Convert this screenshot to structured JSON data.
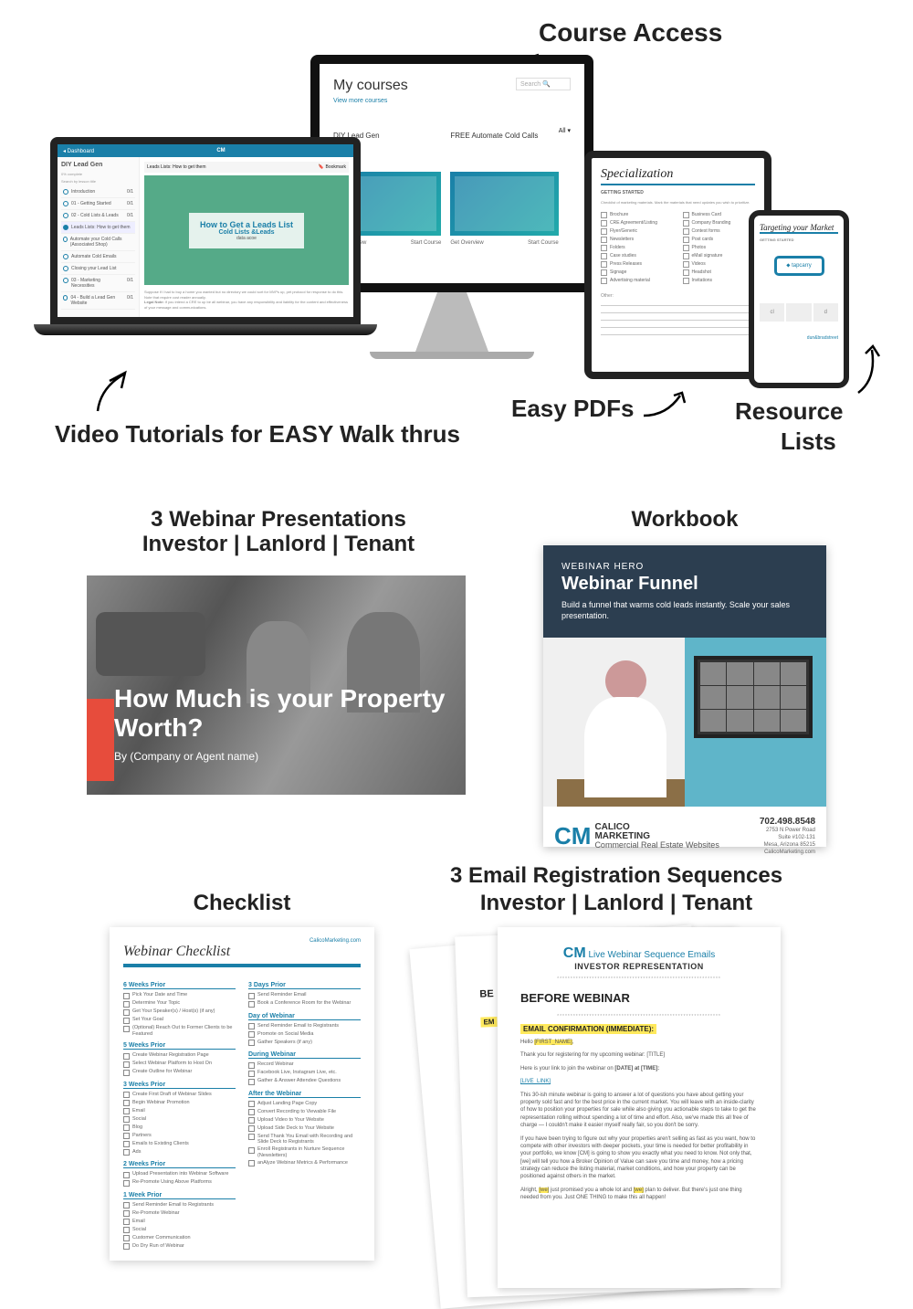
{
  "labels": {
    "course_access": "Course Access",
    "video_tutorials": "Video Tutorials for EASY Walk thrus",
    "easy_pdfs": "Easy PDFs",
    "resource": "Resource",
    "lists": "Lists",
    "webinar_line1": "3 Webinar Presentations",
    "webinar_line2": "Investor | Lanlord | Tenant",
    "workbook": "Workbook",
    "checklist": "Checklist",
    "email_line1": "3 Email Registration Sequences",
    "email_line2": "Investor | Lanlord | Tenant"
  },
  "monitor": {
    "title": "My courses",
    "link": "View more courses",
    "search_ph": "Search",
    "all": "All ▾",
    "cards": [
      {
        "title": "DIY Lead Gen",
        "b1": "Get Overview",
        "b2": "Start Course"
      },
      {
        "title": "FREE Automate Cold Calls",
        "b1": "Get Overview",
        "b2": "Start Course"
      }
    ]
  },
  "laptop": {
    "bar": "◂ Dashboard",
    "side_title": "DIY Lead Gen",
    "progress": "0% complete",
    "search": "Search by lesson title",
    "items": [
      {
        "t": "Introduction",
        "n": "0/1"
      },
      {
        "t": "01 - Getting Started",
        "n": "0/1"
      },
      {
        "t": "02 - Cold Lists & Leads",
        "n": "0/1"
      },
      {
        "t": "Leads Lists: How to get them",
        "n": ""
      },
      {
        "t": "Automate your Cold Calls (Associated Shop)",
        "n": ""
      },
      {
        "t": "Automate Cold Emails",
        "n": ""
      },
      {
        "t": "Closing your Lead List",
        "n": ""
      },
      {
        "t": "03 - Marketing Necessities",
        "n": "0/1"
      },
      {
        "t": "04 - Build a Lead Gen Website",
        "n": "0/1"
      }
    ],
    "content_bar": "Leads Lists: How to get them",
    "bookmark": "🔖 Bookmark",
    "hero_t1": "How to Get a Leads List",
    "hero_t2": "Cold Lists &Leads",
    "hero_t3": "data acoe"
  },
  "tablet": {
    "title": "Specialization",
    "sub": "GETTING STARTED",
    "desc": "Checklist of marketing materials. Mark the materials that need updates you wish to prioritize.",
    "col1": [
      "Brochure",
      "CRE Agreement/Listing",
      "Flyer/Generic",
      "Newsletters",
      "Folders",
      "Case studies",
      "Press Releases",
      "Signage",
      "Advertising material"
    ],
    "col2": [
      "Business Card",
      "Company Branding",
      "Contest forms",
      "Post cards",
      "Photos",
      "eMail signature",
      "Videos",
      "Headshot",
      "Invitations"
    ],
    "other": "Other:"
  },
  "phone": {
    "title": "Targeting your Market",
    "sub": "GETTING STARTED",
    "logo": "⬥ tapcarry",
    "strip": [
      "cl",
      "",
      "d"
    ],
    "foot": "dun&bradstreet"
  },
  "webinar": {
    "heading": "How Much is your Property Worth?",
    "by": "By (Company or Agent name)"
  },
  "wb": {
    "kicker": "WEBINAR HERO",
    "heading": "Webinar Funnel",
    "desc": "Build a funnel that warms cold leads instantly. Scale your sales presentation.",
    "logo_cm": "CM",
    "brand1": "CALICO",
    "brand2": "MARKETING",
    "brand3": "Commercial Real Estate Websites",
    "phone": "702.498.8548",
    "addr1": "2753 N Power Road",
    "addr2": "Suite #102-131",
    "addr3": "Mesa, Arizona 85215",
    "url": "CalicoMarketing.com"
  },
  "cl": {
    "url": "CalicoMarketing.com",
    "title": "Webinar Checklist",
    "left": [
      {
        "h": "6 Weeks Prior",
        "items": [
          "Pick Your Date and Time",
          "Determine Your Topic",
          "Get Your Speaker(s) / Host(s) (if any)",
          "Set Your Goal",
          "(Optional) Reach Out to Former Clients to be Featured"
        ]
      },
      {
        "h": "5 Weeks Prior",
        "items": [
          "Create Webinar Registration Page",
          "Select Webinar Platform to Host On",
          "Create Outline for Webinar"
        ]
      },
      {
        "h": "3 Weeks Prior",
        "items": [
          "Create First Draft of Webinar Slides",
          "Begin Webinar Promotion",
          "Email",
          "Social",
          "Blog",
          "Partners",
          "Emails to Existing Clients",
          "Ads"
        ]
      },
      {
        "h": "2 Weeks Prior",
        "items": [
          "Upload Presentation into Webinar Software",
          "Re-Promote Using Above Platforms"
        ]
      },
      {
        "h": "1 Week Prior",
        "items": [
          "Send Reminder Email to Registrants",
          "Re-Promote Webinar",
          "Email",
          "Social",
          "Customer Communication",
          "Do Dry Run of Webinar"
        ]
      }
    ],
    "right": [
      {
        "h": "3 Days Prior",
        "items": [
          "Send Reminder Email",
          "Book a Conference Room for the Webinar"
        ]
      },
      {
        "h": "Day of Webinar",
        "items": [
          "Send Reminder Email to Registrants",
          "Promote on Social Media",
          "Gather Speakers (if any)"
        ]
      },
      {
        "h": "During Webinar",
        "items": [
          "Record Webinar",
          "Facebook Live, Instagram Live, etc.",
          "Gather & Answer Attendee Questions"
        ]
      },
      {
        "h": "After the Webinar",
        "items": [
          "Adjust Landing Page Copy",
          "Convert Recording to Viewable File",
          "Upload Video to Your Website",
          "Upload Side Deck to Your Website",
          "Send Thank You Email with Recording and Slide Deck to Registrants",
          "Enroll Registrants in Nurture Sequence (Newsletters)",
          "anAlyze Webinar Metrics & Performance"
        ]
      }
    ]
  },
  "email": {
    "logo_cm": "CM",
    "line1": "Live Webinar Sequence Emails",
    "line2": "INVESTOR REPRESENTATION",
    "before": "BEFORE WEBINAR",
    "conf": "EMAIL CONFIRMATION (IMMEDIATE):",
    "hello": "Hello [FIRST_NAME],",
    "p1": "Thank you for registering for my upcoming webinar: [TITLE]",
    "p2a": "Here is your link to join the webinar on ",
    "p2b": "[DATE] at [TIME]:",
    "link": "[LIVE_LINK]",
    "p3": "This 30-ish minute webinar is going to answer a lot of questions you have about getting your property sold fast and for the best price in the current market. You will leave with an inside-clarity of how to position your properties for sale while also giving you actionable steps to take to get the representation rolling without spending a lot of time and effort. Also, we've made this all free of charge — I couldn't make it easier myself really fair, so you don't be sorry.",
    "p4": "If you have been trying to figure out why your properties aren't selling as fast as you want, how to compete with other investors with deeper pockets, your time is needed for better profitability in your portfolio, we know [CM] is going to show you exactly what you need to know. Not only that, [we] will tell you how a Broker Opinion of Value can save you time and money, how a pricing strategy can reduce the listing material, market conditions, and how your property can be positioned against others in the market.",
    "p5a": "Alright, ",
    "p5b": "[we]",
    "p5c": " just promised you a whole lot and ",
    "p5d": "[we]",
    "p5e": " plan to deliver. But there's just one thing needed from you. Just ONE THING to make this all happen!"
  }
}
